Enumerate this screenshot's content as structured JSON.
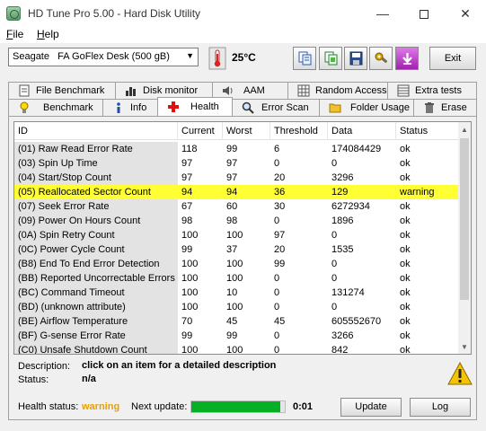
{
  "window": {
    "title": "HD Tune Pro 5.00 - Hard Disk Utility"
  },
  "menu": [
    {
      "accel": "F",
      "rest": "ile"
    },
    {
      "accel": "H",
      "rest": "elp"
    }
  ],
  "toolbar": {
    "drive_selected": "Seagate   FA GoFlex Desk (500 gB)",
    "temperature": "25°C",
    "exit_label": "Exit",
    "icons": [
      "copy-info-icon",
      "copy-screenshot-icon",
      "save-icon",
      "options-icon",
      "download-icon"
    ]
  },
  "tabs_top": [
    "File Benchmark",
    "Disk monitor",
    "AAM",
    "Random Access",
    "Extra tests"
  ],
  "tabs_bottom": [
    "Benchmark",
    "Info",
    "Health",
    "Error Scan",
    "Folder Usage",
    "Erase"
  ],
  "active_tab": "Health",
  "table": {
    "headers": [
      "ID",
      "Current",
      "Worst",
      "Threshold",
      "Data",
      "Status"
    ],
    "rows": [
      [
        "(01) Raw Read Error Rate",
        "118",
        "99",
        "6",
        "174084429",
        "ok"
      ],
      [
        "(03) Spin Up Time",
        "97",
        "97",
        "0",
        "0",
        "ok"
      ],
      [
        "(04) Start/Stop Count",
        "97",
        "97",
        "20",
        "3296",
        "ok"
      ],
      [
        "(05) Reallocated Sector Count",
        "94",
        "94",
        "36",
        "129",
        "warning"
      ],
      [
        "(07) Seek Error Rate",
        "67",
        "60",
        "30",
        "6272934",
        "ok"
      ],
      [
        "(09) Power On Hours Count",
        "98",
        "98",
        "0",
        "1896",
        "ok"
      ],
      [
        "(0A) Spin Retry Count",
        "100",
        "100",
        "97",
        "0",
        "ok"
      ],
      [
        "(0C) Power Cycle Count",
        "99",
        "37",
        "20",
        "1535",
        "ok"
      ],
      [
        "(B8) End To End Error Detection",
        "100",
        "100",
        "99",
        "0",
        "ok"
      ],
      [
        "(BB) Reported Uncorrectable Errors",
        "100",
        "100",
        "0",
        "0",
        "ok"
      ],
      [
        "(BC) Command Timeout",
        "100",
        "10",
        "0",
        "131274",
        "ok"
      ],
      [
        "(BD) (unknown attribute)",
        "100",
        "100",
        "0",
        "0",
        "ok"
      ],
      [
        "(BE) Airflow Temperature",
        "70",
        "45",
        "45",
        "605552670",
        "ok"
      ],
      [
        "(BF) G-sense Error Rate",
        "99",
        "99",
        "0",
        "3266",
        "ok"
      ],
      [
        "(C0) Unsafe Shutdown Count",
        "100",
        "100",
        "0",
        "842",
        "ok"
      ]
    ]
  },
  "description": {
    "desc_label": "Description:",
    "desc_value": "click on an item for a detailed description",
    "status_label": "Status:",
    "status_value": "n/a"
  },
  "statusbar": {
    "health_label": "Health status:",
    "health_value": "warning",
    "next_label": "Next update:",
    "progress": 0.95,
    "time": "0:01",
    "update_label": "Update",
    "log_label": "Log"
  },
  "colors": {
    "warning_row": "#ffff33",
    "health_warning_text": "#e8a000",
    "progress_fill": "#06b025"
  }
}
